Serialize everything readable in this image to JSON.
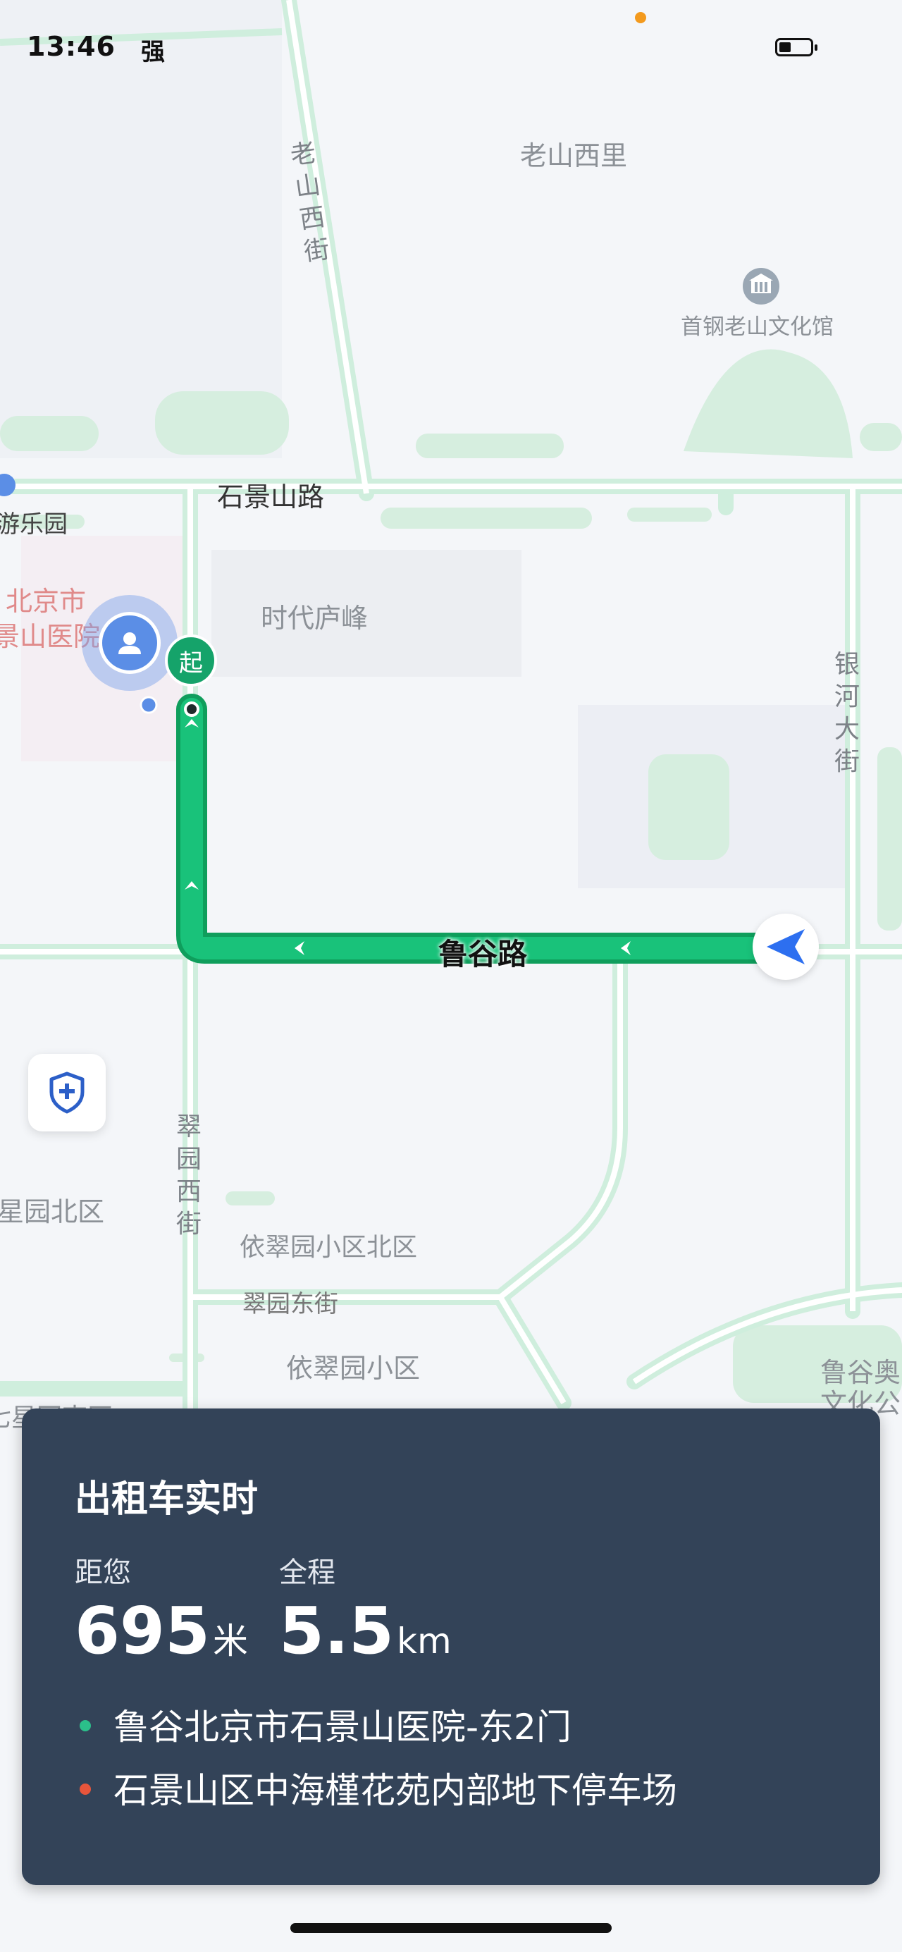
{
  "status_bar": {
    "time": "13:46",
    "signal": "强"
  },
  "map": {
    "labels": {
      "laoshan_xili": "老山西里",
      "laoshan_xijie": "老山西街",
      "culture_hall": "首钢老山文化馆",
      "shijingshan_road": "石景山路",
      "amusement_park": "游乐园",
      "hospital_line1": "北京市",
      "hospital_line2": "景山医院",
      "shidai_lufeng": "时代庐峰",
      "yinhe_street": "银河大街",
      "lugu_road": "鲁谷路",
      "cuiyuan_xijie": "翠园西街",
      "xingyuan_north": "星园北区",
      "yicuiyuan_north": "依翠园小区北区",
      "cuiyuan_dongjie": "翠园东街",
      "yicuiyuan": "依翠园小区",
      "lugu_culture_line1": "鲁谷奥",
      "lugu_culture_line2": "文化公",
      "cutoff_label": "七星园南区",
      "start_badge": "起"
    },
    "icons": {
      "culture_hall": "museum-icon",
      "safety": "shield-plus-icon",
      "avatar": "person-icon",
      "car": "navigation-arrow-icon"
    },
    "route_color": "#19c27a"
  },
  "trip_panel": {
    "title": "出租车实时",
    "distance_label": "距您",
    "distance_value": "695",
    "distance_unit": "米",
    "total_label": "全程",
    "total_value": "5.5",
    "total_unit": "km",
    "origin": "鲁谷北京市石景山医院-东2门",
    "destination": "石景山区中海槿花苑内部地下停车场",
    "origin_color": "#2bbf8a",
    "destination_color": "#e8553b"
  }
}
